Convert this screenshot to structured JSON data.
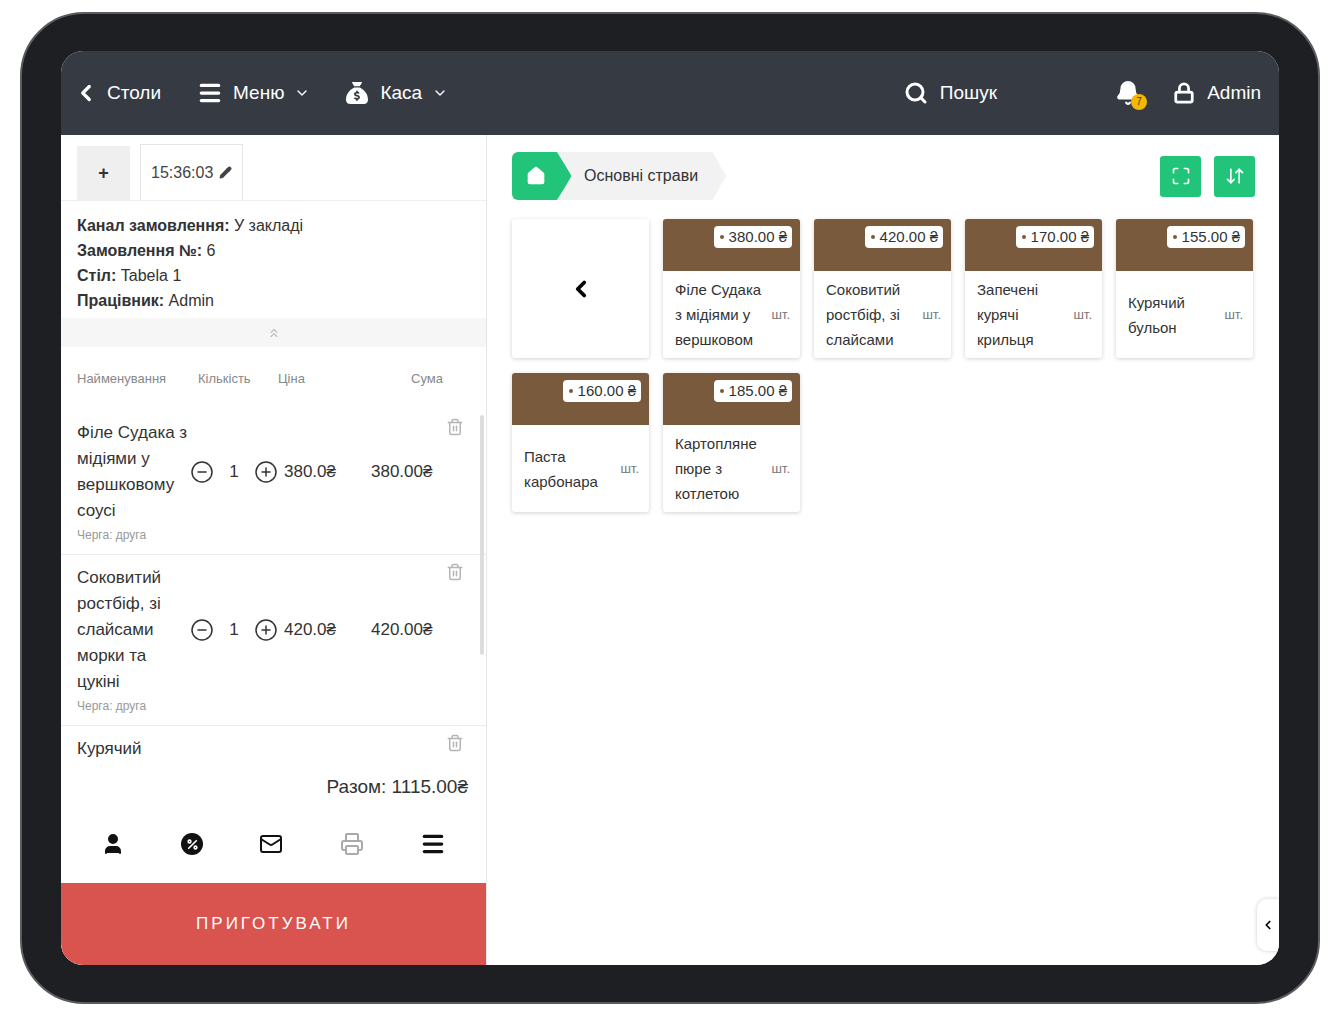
{
  "topbar": {
    "back": "Столи",
    "menu": "Меню",
    "cash": "Каса",
    "search": "Пошук",
    "notifications": "7",
    "user": "Admin"
  },
  "order": {
    "add_tab": "+",
    "time": "15:36:03",
    "info": [
      {
        "label": "Канал замовлення:",
        "value": "У закладі"
      },
      {
        "label": "Замовлення №:",
        "value": "6"
      },
      {
        "label": "Стіл:",
        "value": "Tabela 1"
      },
      {
        "label": "Працівник:",
        "value": "Admin"
      }
    ],
    "columns": [
      "Найменування",
      "Кількість",
      "Ціна",
      "Сума"
    ],
    "items": [
      {
        "name": "Філе Судака з мідіями у вершковому соусі",
        "qty": "1",
        "price": "380.0₴",
        "sum": "380.00₴",
        "queue": "Черга: друга"
      },
      {
        "name": "Соковитий ростбіф, зі слайсами морки та цукіні",
        "qty": "1",
        "price": "420.0₴",
        "sum": "420.00₴",
        "queue": "Черга: друга"
      },
      {
        "name": "Курячий"
      }
    ],
    "total": "Разом: 1115.00₴",
    "print_disabled": true,
    "submit": "ПРИГОТУВАТИ"
  },
  "catalog": {
    "breadcrumb": "Основні страви",
    "dishes": [
      {
        "price": "380.00 ₴",
        "name": "Філе Судака з мідіями у вершковом",
        "unit": "шт."
      },
      {
        "price": "420.00 ₴",
        "name": "Соковитий ростбіф, зі слайсами",
        "unit": "шт."
      },
      {
        "price": "170.00 ₴",
        "name": "Запечені курячі крильця",
        "unit": "шт."
      },
      {
        "price": "155.00 ₴",
        "name": "Курячий бульон",
        "unit": "шт."
      },
      {
        "price": "160.00 ₴",
        "name": "Паста карбонара",
        "unit": "шт."
      },
      {
        "price": "185.00 ₴",
        "name": "Картопляне пюре з котлетою",
        "unit": "шт."
      }
    ]
  }
}
